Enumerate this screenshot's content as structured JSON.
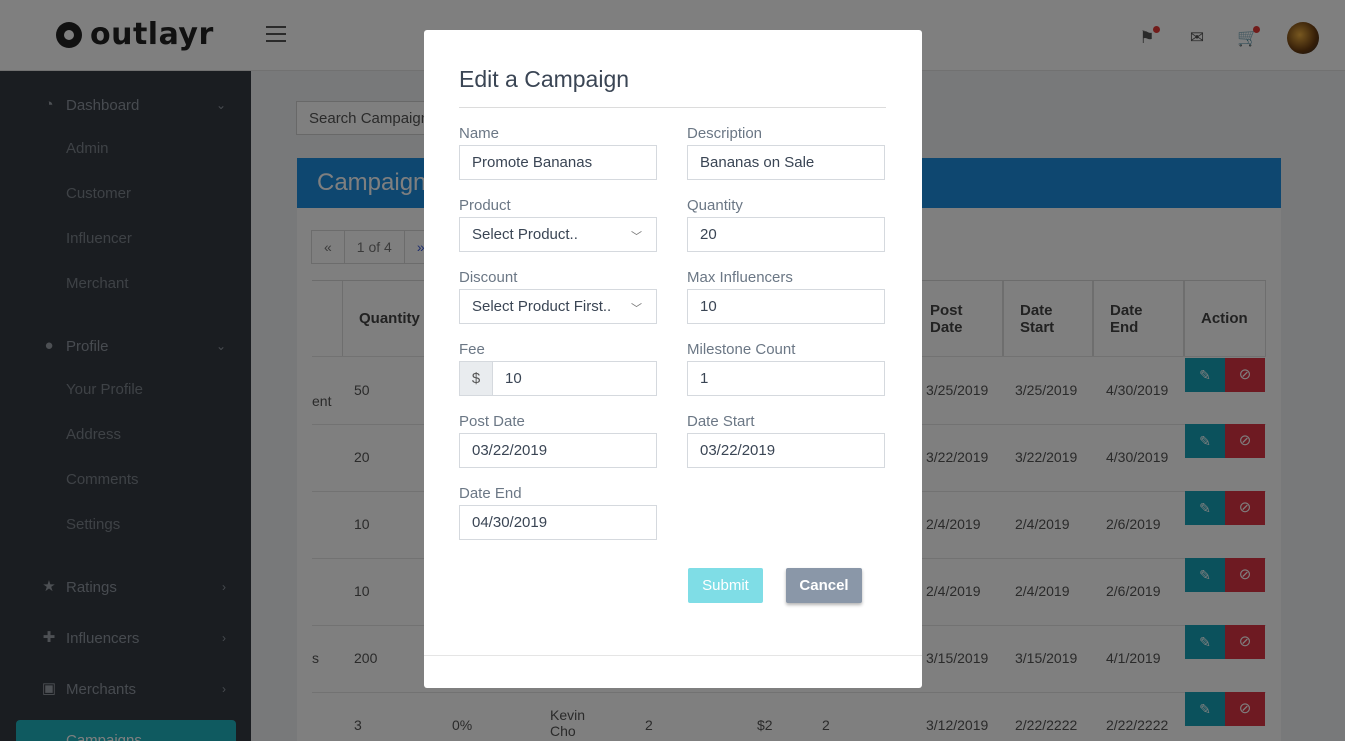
{
  "header": {
    "logo_text": "outlayr",
    "icons": [
      "flag-icon",
      "mail-icon",
      "cart-icon"
    ]
  },
  "sidebar": {
    "sections": [
      {
        "label": "Dashboard",
        "icon": "dashboard-icon",
        "items": [
          "Admin",
          "Customer",
          "Influencer",
          "Merchant"
        ]
      },
      {
        "label": "Profile",
        "icon": "person-icon",
        "items": [
          "Your Profile",
          "Address",
          "Comments",
          "Settings"
        ]
      },
      {
        "label": "Ratings",
        "icon": "star-icon"
      },
      {
        "label": "Influencers",
        "icon": "add-person-icon"
      },
      {
        "label": "Merchants",
        "icon": "badge-icon"
      },
      {
        "label": "Campaigns",
        "icon": "megaphone-icon"
      }
    ]
  },
  "main": {
    "search_placeholder": "Search Campaigns",
    "panel_title": "Campaigns",
    "pager": {
      "prev": "«",
      "page": "1 of 4",
      "next": "»"
    },
    "columns": [
      "Quantity",
      "Post Date",
      "Date Start",
      "Date End",
      "Action"
    ],
    "rows": [
      {
        "name_tail": "ent",
        "quantity": "50",
        "post_date": "3/25/2019",
        "date_start": "3/25/2019",
        "date_end": "4/30/2019"
      },
      {
        "name_tail": "",
        "quantity": "20",
        "post_date": "3/22/2019",
        "date_start": "3/22/2019",
        "date_end": "4/30/2019"
      },
      {
        "name_tail": "",
        "quantity": "10",
        "post_date": "2/4/2019",
        "date_start": "2/4/2019",
        "date_end": "2/6/2019"
      },
      {
        "name_tail": "",
        "quantity": "10",
        "post_date": "2/4/2019",
        "date_start": "2/4/2019",
        "date_end": "2/6/2019"
      },
      {
        "name_tail": "s",
        "quantity": "200",
        "post_date": "3/15/2019",
        "date_start": "3/15/2019",
        "date_end": "4/1/2019"
      },
      {
        "name_tail": "",
        "quantity": "3",
        "discount": "0%",
        "influencer": "Kevin Cho",
        "max": "2",
        "fee": "$2",
        "milestone": "2",
        "post_date": "3/12/2019",
        "date_start": "2/22/2222",
        "date_end": "2/22/2222"
      }
    ]
  },
  "modal": {
    "title": "Edit a Campaign",
    "fields": {
      "name": {
        "label": "Name",
        "value": "Promote Bananas"
      },
      "description": {
        "label": "Description",
        "value": "Bananas on Sale"
      },
      "product": {
        "label": "Product",
        "value": "Select Product.."
      },
      "quantity": {
        "label": "Quantity",
        "value": "20"
      },
      "discount": {
        "label": "Discount",
        "value": "Select Product First.."
      },
      "max_influencers": {
        "label": "Max Influencers",
        "value": "10"
      },
      "fee": {
        "label": "Fee",
        "prefix": "$",
        "value": "10"
      },
      "milestone_count": {
        "label": "Milestone Count",
        "value": "1"
      },
      "post_date": {
        "label": "Post Date",
        "value": "03/22/2019"
      },
      "date_start": {
        "label": "Date Start",
        "value": "03/22/2019"
      },
      "date_end": {
        "label": "Date End",
        "value": "04/30/2019"
      }
    },
    "submit_label": "Submit",
    "cancel_label": "Cancel"
  },
  "colors": {
    "sidebar_bg": "#353a42",
    "panel_blue": "#1d8fe0",
    "accent_teal": "#1fb5c0",
    "danger": "#dc3545",
    "cancel_gray": "#8a97a8"
  }
}
